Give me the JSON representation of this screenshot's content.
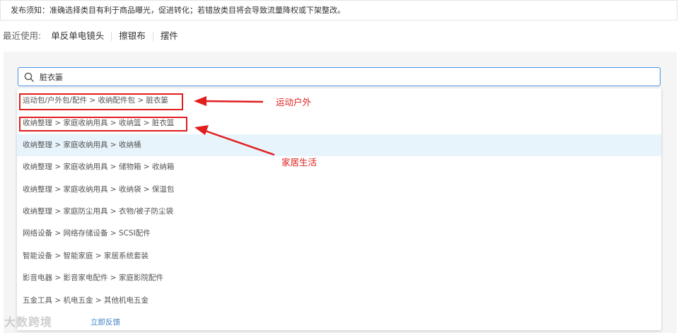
{
  "notice": {
    "text": "发布须知：准确选择类目有利于商品曝光，促进转化；若错放类目将会导致流量降权或下架整改。"
  },
  "recent": {
    "label": "最近使用:",
    "items": [
      "单反单电镜头",
      "擦银布",
      "摆件"
    ]
  },
  "search": {
    "value": "脏衣篓",
    "icon": "search-icon"
  },
  "results": [
    "运动包/户外包/配件 > 收纳配件包 > 脏衣篓",
    "收纳整理 > 家庭收纳用具 > 收纳篮 > 脏衣篮",
    "收纳整理 > 家庭收纳用具 > 收纳桶",
    "收纳整理 > 家庭收纳用具 > 储物箱 > 收纳箱",
    "收纳整理 > 家庭收纳用具 > 收纳袋 > 保温包",
    "收纳整理 > 家庭防尘用具 > 衣物/被子防尘袋",
    "网络设备 > 网络存储设备 > SCSI配件",
    "智能设备 > 智能家庭 > 家居系统套装",
    "影音电器 > 影音家电配件 > 家庭影院配件",
    "五金工具 > 机电五金 > 其他机电五金"
  ],
  "highlighted_index": 2,
  "feedback": {
    "link": "立即反馈"
  },
  "annotations": {
    "outdoor": "运动户外",
    "home": "家居生活",
    "color": "#e11d1d"
  },
  "watermark": "大数跨境"
}
